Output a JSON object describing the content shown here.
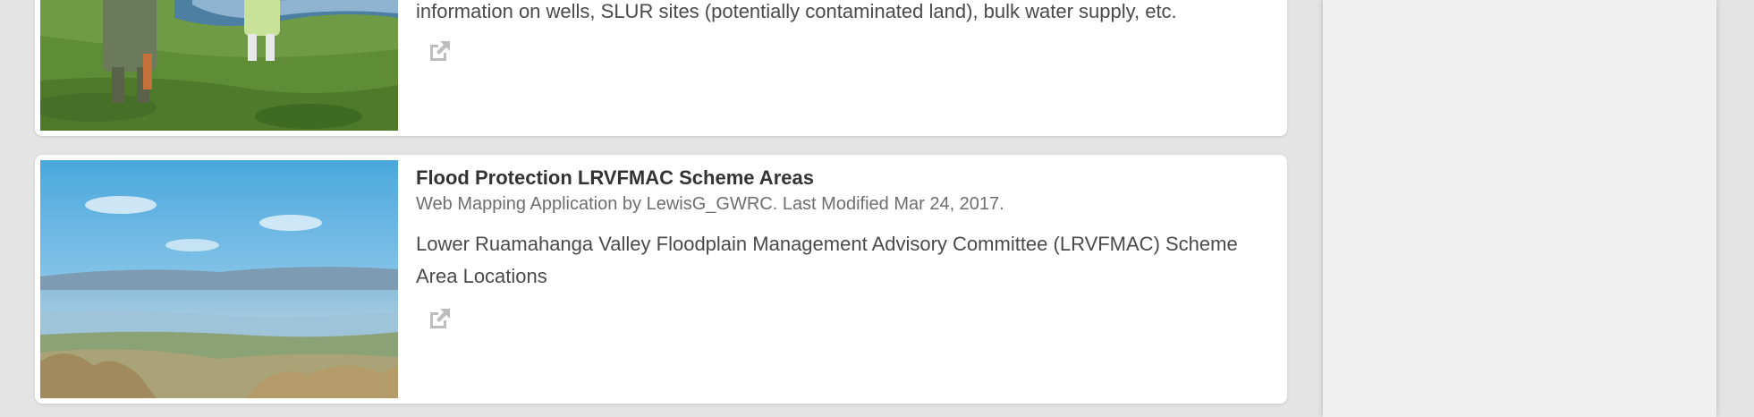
{
  "items": [
    {
      "description": "information on wells, SLUR sites (potentially contaminated land), bulk water supply, etc.",
      "open_icon": "external-link-icon"
    },
    {
      "title": "Flood Protection LRVFMAC Scheme Areas",
      "meta": "Web Mapping Application by LewisG_GWRC. Last Modified Mar 24, 2017.",
      "description": "Lower Ruamahanga Valley Floodplain Management Advisory Committee (LRVFMAC) Scheme Area Locations",
      "open_icon": "external-link-icon"
    }
  ],
  "colors": {
    "background": "#e4e4e4",
    "card": "#ffffff",
    "sidebar": "#f0f0f0",
    "title_text": "#333333",
    "meta_text": "#6e6e6e",
    "icon": "#bdbdbd"
  }
}
